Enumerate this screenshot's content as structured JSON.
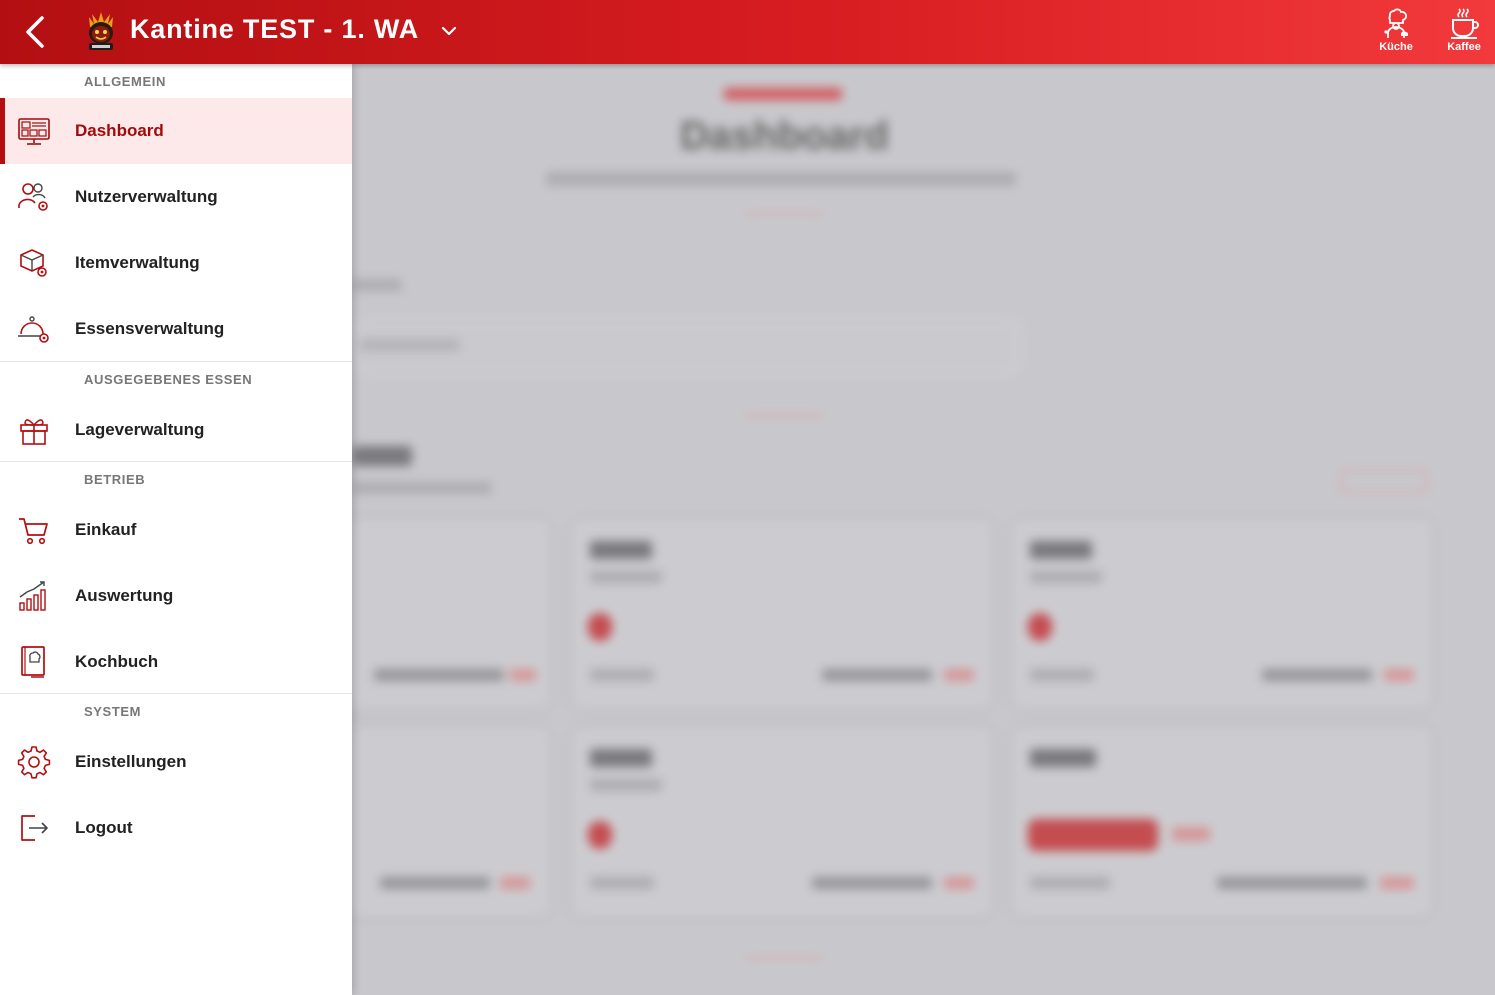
{
  "header": {
    "title": "Kantine TEST - 1. WA",
    "back_icon": "chevron-left-icon",
    "logo_icon": "mascot-logo",
    "actions": [
      {
        "label": "Küche",
        "icon": "chef-icon"
      },
      {
        "label": "Kaffee",
        "icon": "coffee-cup-icon"
      }
    ]
  },
  "sidebar": {
    "sections": {
      "allgemein": "ALLGEMEIN",
      "ausgegeben": "AUSGEGEBENES ESSEN",
      "betrieb": "BETRIEB",
      "system": "SYSTEM"
    },
    "items": [
      {
        "label": "Dashboard",
        "icon": "dashboard-monitor-icon",
        "active": true
      },
      {
        "label": "Nutzerverwaltung",
        "icon": "users-gear-icon"
      },
      {
        "label": "Itemverwaltung",
        "icon": "box-gear-icon"
      },
      {
        "label": "Essensverwaltung",
        "icon": "cloche-gear-icon"
      },
      {
        "label": "Lageverwaltung",
        "icon": "gift-icon"
      },
      {
        "label": "Einkauf",
        "icon": "cart-icon"
      },
      {
        "label": "Auswertung",
        "icon": "bar-chart-icon"
      },
      {
        "label": "Kochbuch",
        "icon": "cookbook-icon"
      },
      {
        "label": "Einstellungen",
        "icon": "gear-icon"
      },
      {
        "label": "Logout",
        "icon": "logout-icon"
      }
    ]
  },
  "background": {
    "page_title": "Dashboard",
    "colors": {
      "accent": "#d81d21",
      "accent_dark": "#a10b0d",
      "active_bg": "#fde9e9"
    }
  }
}
